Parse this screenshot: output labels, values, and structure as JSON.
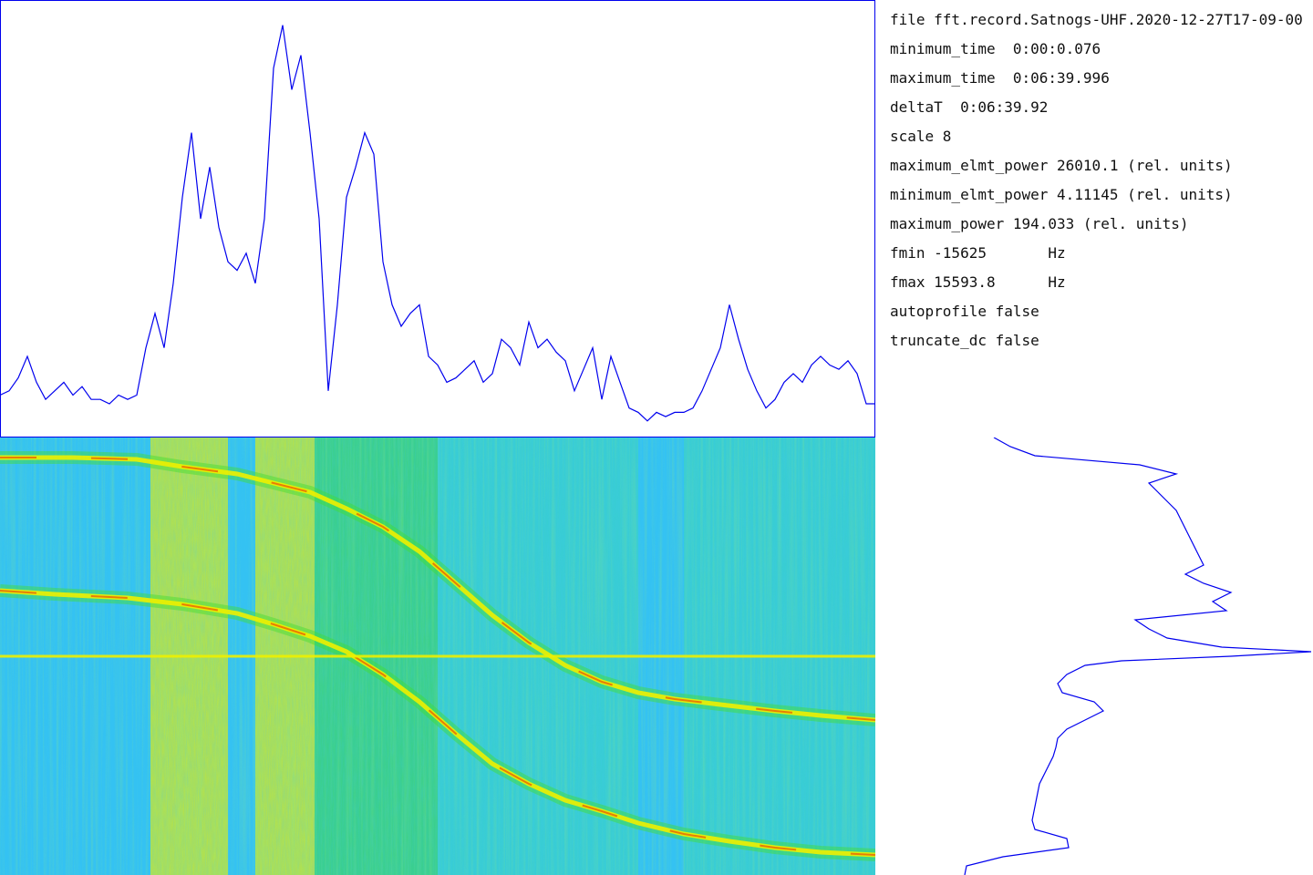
{
  "info": {
    "lines": [
      "file fft.record.Satnogs-UHF.2020-12-27T17-09-00",
      "minimum_time  0:00:0.076",
      "maximum_time  0:06:39.996",
      "deltaT  0:06:39.92",
      "scale 8",
      "maximum_elmt_power 26010.1 (rel. units)",
      "minimum_elmt_power 4.11145 (rel. units)",
      "maximum_power 194.033 (rel. units)",
      "fmin -15625       Hz",
      "fmax 15593.8      Hz",
      "autoprofile false",
      "truncate_dc false"
    ]
  },
  "colors": {
    "trace": "#0000ee",
    "background_noise": "#33c2f2",
    "low_power": "#40e0a0",
    "mid_power": "#40dd30",
    "high_power": "#eef000",
    "peak_power": "#ee2200"
  },
  "chart_data": [
    {
      "type": "line",
      "x": [
        0,
        10,
        20,
        30,
        40,
        50,
        60,
        70,
        80,
        90,
        100,
        110,
        120,
        130,
        140,
        150,
        160,
        170,
        180,
        190,
        200,
        210,
        220,
        230,
        240,
        250,
        260,
        270,
        280,
        290,
        300,
        310,
        320,
        330,
        340,
        350,
        360,
        370,
        380,
        390,
        400,
        410,
        420,
        430,
        440,
        450,
        460,
        470,
        480,
        490,
        500,
        510,
        520,
        530,
        540,
        550,
        560,
        570,
        580,
        590,
        600,
        610,
        620,
        630,
        640,
        650,
        660,
        670,
        680,
        690,
        700,
        710,
        720,
        730,
        740,
        750,
        760,
        770,
        780,
        790,
        800,
        810,
        820,
        830,
        840,
        850,
        860,
        870,
        880,
        890,
        900,
        910,
        920,
        930,
        940,
        950,
        960
      ],
      "y": [
        0.09,
        0.1,
        0.13,
        0.18,
        0.12,
        0.08,
        0.1,
        0.12,
        0.09,
        0.11,
        0.08,
        0.08,
        0.07,
        0.09,
        0.08,
        0.09,
        0.2,
        0.28,
        0.2,
        0.35,
        0.55,
        0.7,
        0.5,
        0.62,
        0.48,
        0.4,
        0.38,
        0.42,
        0.35,
        0.5,
        0.85,
        0.95,
        0.8,
        0.88,
        0.7,
        0.5,
        0.1,
        0.3,
        0.55,
        0.62,
        0.7,
        0.65,
        0.4,
        0.3,
        0.25,
        0.28,
        0.3,
        0.18,
        0.16,
        0.12,
        0.13,
        0.15,
        0.17,
        0.12,
        0.14,
        0.22,
        0.2,
        0.16,
        0.26,
        0.2,
        0.22,
        0.19,
        0.17,
        0.1,
        0.15,
        0.2,
        0.08,
        0.18,
        0.12,
        0.06,
        0.05,
        0.03,
        0.05,
        0.04,
        0.05,
        0.05,
        0.06,
        0.1,
        0.15,
        0.2,
        0.3,
        0.22,
        0.15,
        0.1,
        0.06,
        0.08,
        0.12,
        0.14,
        0.12,
        0.16,
        0.18,
        0.16,
        0.15,
        0.17,
        0.14,
        0.07,
        0.07
      ],
      "xlim": [
        0,
        960
      ],
      "ylim": [
        0,
        1
      ],
      "grid": false
    },
    {
      "type": "heatmap",
      "xlim": [
        0,
        960
      ],
      "ylim": [
        0,
        480
      ],
      "carriers": [
        {
          "x": [
            0,
            80,
            150,
            200,
            260,
            300,
            340,
            380,
            420,
            460,
            500,
            540,
            580,
            620,
            660,
            700,
            740,
            790,
            850,
            900,
            960
          ],
          "y": [
            22,
            22,
            24,
            32,
            40,
            50,
            60,
            78,
            98,
            125,
            160,
            195,
            225,
            250,
            268,
            280,
            287,
            293,
            300,
            305,
            310
          ]
        },
        {
          "x": [
            0,
            60,
            140,
            200,
            260,
            300,
            340,
            380,
            420,
            460,
            500,
            540,
            580,
            620,
            660,
            700,
            750,
            800,
            850,
            900,
            960
          ],
          "y": [
            168,
            172,
            176,
            183,
            193,
            205,
            218,
            235,
            260,
            290,
            325,
            358,
            380,
            398,
            410,
            423,
            435,
            443,
            450,
            455,
            458
          ]
        }
      ],
      "dc_line_y": 240,
      "bright_regions": [
        {
          "x": [
            165,
            250
          ],
          "level": "high"
        },
        {
          "x": [
            280,
            345
          ],
          "level": "high"
        },
        {
          "x": [
            345,
            480
          ],
          "level": "mid"
        },
        {
          "x": [
            480,
            700
          ],
          "level": "low"
        },
        {
          "x": [
            750,
            960
          ],
          "level": "low"
        }
      ]
    },
    {
      "type": "line",
      "y": [
        0,
        10,
        20,
        30,
        40,
        50,
        60,
        70,
        80,
        90,
        100,
        110,
        120,
        130,
        140,
        150,
        160,
        170,
        180,
        190,
        200,
        210,
        220,
        230,
        235,
        240,
        245,
        250,
        260,
        270,
        280,
        290,
        300,
        310,
        320,
        330,
        340,
        350,
        360,
        370,
        380,
        390,
        400,
        410,
        420,
        430,
        440,
        450,
        460,
        470,
        480
      ],
      "x": [
        130,
        148,
        175,
        290,
        330,
        300,
        310,
        320,
        330,
        335,
        340,
        345,
        350,
        355,
        360,
        340,
        360,
        390,
        370,
        385,
        285,
        300,
        320,
        380,
        478,
        390,
        270,
        230,
        210,
        200,
        205,
        240,
        250,
        230,
        210,
        200,
        198,
        195,
        190,
        185,
        180,
        178,
        176,
        174,
        172,
        175,
        210,
        212,
        140,
        100,
        98
      ],
      "xlim": [
        0,
        480
      ],
      "ylim": [
        0,
        480
      ],
      "grid": false
    }
  ]
}
